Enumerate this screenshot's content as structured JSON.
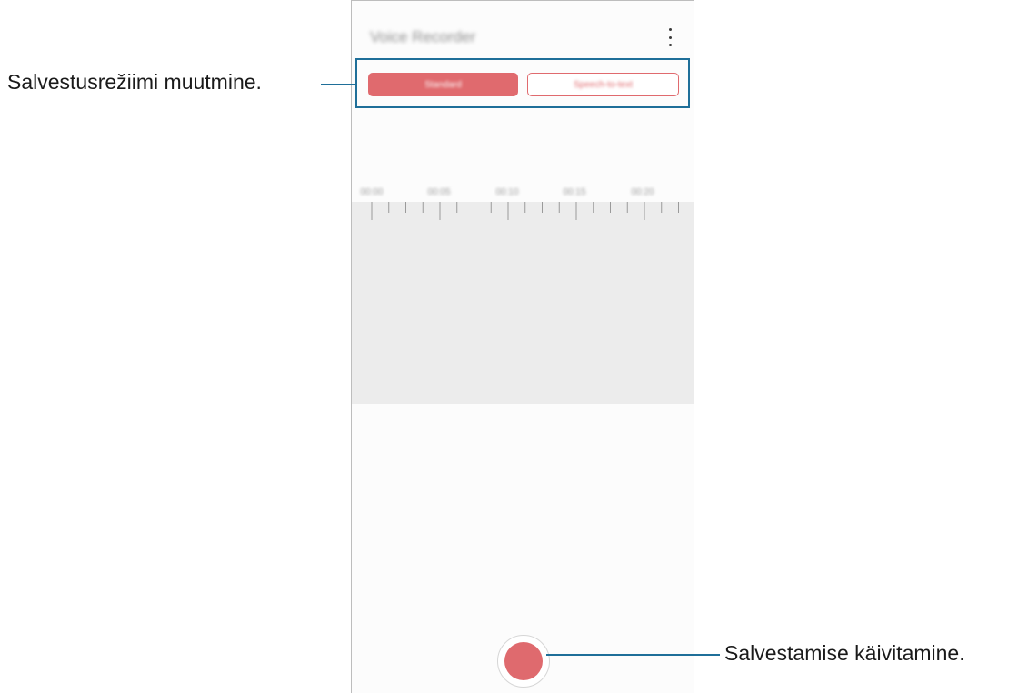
{
  "app": {
    "title": "Voice Recorder"
  },
  "tabs": [
    {
      "label": "Standard",
      "active": true
    },
    {
      "label": "Speech-to-text",
      "active": false
    }
  ],
  "timeline": {
    "labels": [
      "00:00",
      "00:05",
      "00:10",
      "00:15",
      "00:20"
    ]
  },
  "callouts": {
    "mode_change": "Salvestusrežiimi muutmine.",
    "start_recording": "Salvestamise käivitamine."
  },
  "colors": {
    "accent": "#e06a6e",
    "callout_line": "#1f6f99",
    "wave_background": "#ececec"
  }
}
